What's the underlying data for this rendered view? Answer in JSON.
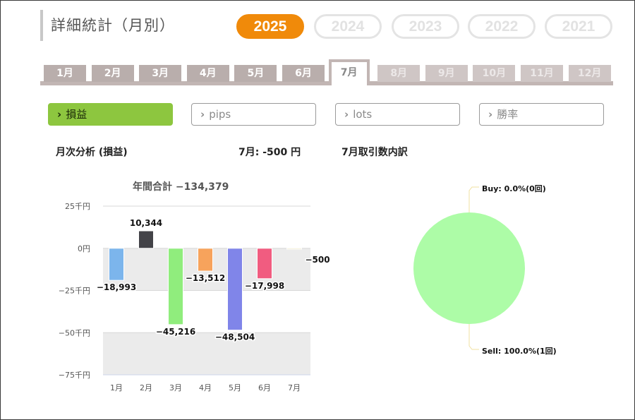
{
  "header": {
    "title": "詳細統計（月別）"
  },
  "years": [
    {
      "label": "2025",
      "active": true
    },
    {
      "label": "2024",
      "active": false
    },
    {
      "label": "2023",
      "active": false
    },
    {
      "label": "2022",
      "active": false
    },
    {
      "label": "2021",
      "active": false
    }
  ],
  "months": [
    {
      "label": "1月",
      "state": "past"
    },
    {
      "label": "2月",
      "state": "past"
    },
    {
      "label": "3月",
      "state": "past"
    },
    {
      "label": "4月",
      "state": "past"
    },
    {
      "label": "5月",
      "state": "past"
    },
    {
      "label": "6月",
      "state": "past"
    },
    {
      "label": "7月",
      "state": "active"
    },
    {
      "label": "8月",
      "state": "future"
    },
    {
      "label": "9月",
      "state": "future"
    },
    {
      "label": "10月",
      "state": "future"
    },
    {
      "label": "11月",
      "state": "future"
    },
    {
      "label": "12月",
      "state": "future"
    }
  ],
  "metrics": {
    "chevron": "›",
    "items": [
      {
        "label": "損益",
        "active": true
      },
      {
        "label": "pips",
        "active": false
      },
      {
        "label": "lots",
        "active": false
      },
      {
        "label": "勝率",
        "active": false
      }
    ]
  },
  "monthly": {
    "heading": "月次分析 (損益)",
    "current": "7月:  -500 円"
  },
  "breakdown": {
    "heading": "7月取引数内訳"
  },
  "colors": {
    "accent": "#f08a0a",
    "active_metric": "#8dc63f",
    "tab": "#b9aeac",
    "pie_fill": "#adfca7",
    "leader_line": "#f0e0a0"
  },
  "chart_data": [
    {
      "type": "bar",
      "title": "年間合計 −134,379",
      "categories": [
        "1月",
        "2月",
        "3月",
        "4月",
        "5月",
        "6月",
        "7月"
      ],
      "values": [
        -18993,
        10344,
        -45216,
        -13512,
        -48504,
        -17998,
        -500
      ],
      "data_labels": [
        "−18,993",
        "10,344",
        "−45,216",
        "−13,512",
        "−48,504",
        "−17,998",
        "−500"
      ],
      "bar_colors": [
        "#7cb5ec",
        "#434348",
        "#90ed7d",
        "#f7a35c",
        "#8085e9",
        "#f15c80",
        "#e4d354"
      ],
      "yticks": [
        25000,
        0,
        -25000,
        -50000,
        -75000
      ],
      "ytick_labels": [
        "25千円",
        "0円",
        "−25千円",
        "−50千円",
        "−75千円"
      ],
      "ylim": [
        -75000,
        25000
      ],
      "grid": true,
      "xlabel": "",
      "ylabel": ""
    },
    {
      "type": "pie",
      "labels": [
        "Buy",
        "Sell"
      ],
      "values": [
        0,
        100
      ],
      "data_labels": [
        "Buy: 0.0%(0回)",
        "Sell: 100.0%(1回)"
      ],
      "colors": [
        "#7cb5ec",
        "#adfca7"
      ]
    }
  ]
}
